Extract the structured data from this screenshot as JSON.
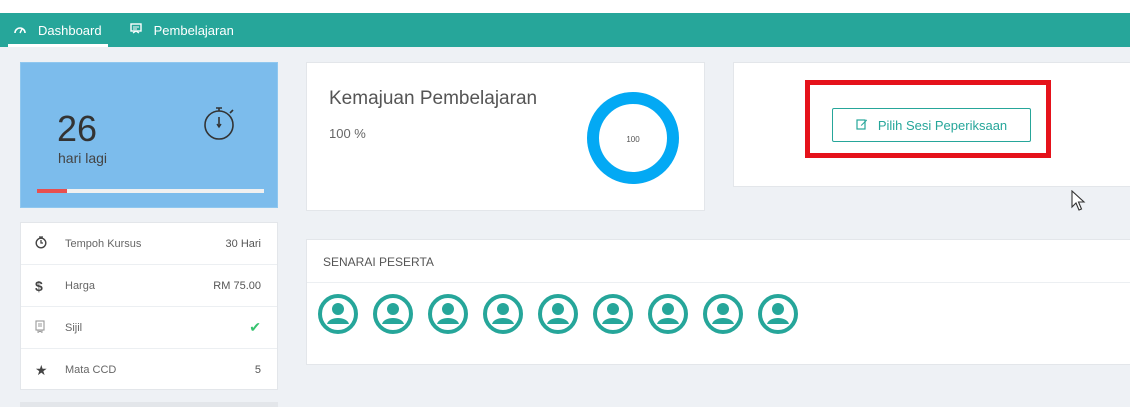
{
  "nav": {
    "items": [
      {
        "label": "Dashboard",
        "icon": "dashboard-gauge-icon",
        "active": true
      },
      {
        "label": "Pembelajaran",
        "icon": "learning-board-icon",
        "active": false
      }
    ]
  },
  "countdown": {
    "days": "26",
    "label": "hari lagi",
    "icon": "stopwatch-icon",
    "progress_fraction": 0.13,
    "progress_color": "#e94f4f",
    "background": "#7cbcec"
  },
  "course_info": {
    "rows": [
      {
        "icon": "clock-icon",
        "label": "Tempoh Kursus",
        "value": "30 Hari"
      },
      {
        "icon": "dollar-icon",
        "label": "Harga",
        "value": "RM 75.00"
      },
      {
        "icon": "certificate-icon",
        "label": "Sijil",
        "value": "✔"
      },
      {
        "icon": "star-icon",
        "label": "Mata CCD",
        "value": "5"
      }
    ]
  },
  "progress": {
    "title": "Kemajuan Pembelajaran",
    "percent_text": "100 %",
    "donut_value": "100",
    "fraction": 1.0,
    "color": "#03a9f4"
  },
  "exam": {
    "button_label": "Pilih Sesi Peperiksaan",
    "icon": "edit-icon",
    "accent": "#26a69a",
    "highlight_color": "#e5121b"
  },
  "participants": {
    "header": "SENARAI PESERTA",
    "count": 9,
    "icon": "user-circle-icon",
    "color": "#26a69a"
  },
  "theme": {
    "navbar": "#26a69a",
    "page_background": "#eef1f5"
  }
}
